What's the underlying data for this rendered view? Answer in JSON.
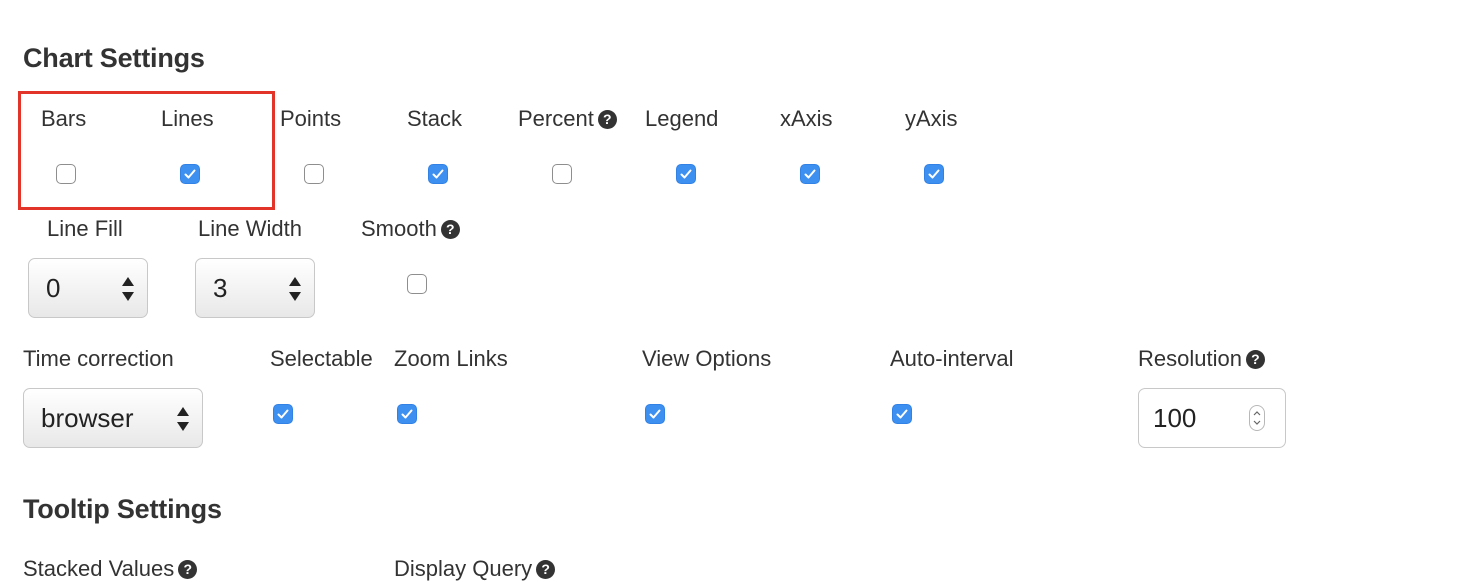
{
  "chart_settings": {
    "title": "Chart Settings",
    "toggles": [
      {
        "label": "Bars",
        "checked": false
      },
      {
        "label": "Lines",
        "checked": true
      },
      {
        "label": "Points",
        "checked": false
      },
      {
        "label": "Stack",
        "checked": true
      },
      {
        "label": "Percent",
        "checked": false,
        "help": true
      },
      {
        "label": "Legend",
        "checked": true
      },
      {
        "label": "xAxis",
        "checked": true
      },
      {
        "label": "yAxis",
        "checked": true
      }
    ],
    "line_fill": {
      "label": "Line Fill",
      "value": "0"
    },
    "line_width": {
      "label": "Line Width",
      "value": "3"
    },
    "smooth": {
      "label": "Smooth",
      "checked": false,
      "help": true
    },
    "time_correction": {
      "label": "Time correction",
      "value": "browser"
    },
    "selectable": {
      "label": "Selectable",
      "checked": true
    },
    "zoom_links": {
      "label": "Zoom Links",
      "checked": true
    },
    "view_options": {
      "label": "View Options",
      "checked": true
    },
    "auto_interval": {
      "label": "Auto-interval",
      "checked": true
    },
    "resolution": {
      "label": "Resolution",
      "value": "100",
      "help": true
    }
  },
  "tooltip_settings": {
    "title": "Tooltip Settings",
    "stacked_values": {
      "label": "Stacked Values",
      "help": true
    },
    "display_query": {
      "label": "Display Query",
      "help": true
    }
  },
  "help_glyph": "?",
  "colors": {
    "checkbox_on": "#3d8ff0",
    "highlight": "#e3342a",
    "text": "#333333"
  }
}
